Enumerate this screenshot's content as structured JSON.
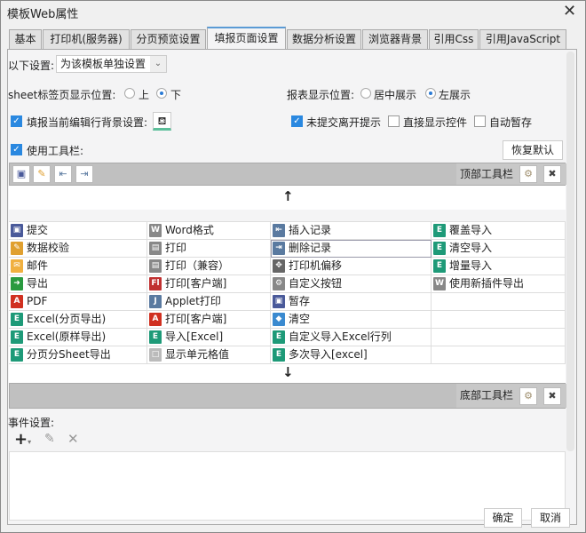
{
  "window": {
    "title": "模板Web属性"
  },
  "tabs": [
    "基本",
    "打印机(服务器)",
    "分页预览设置",
    "填报页面设置",
    "数据分析设置",
    "浏览器背景",
    "引用Css",
    "引用JavaScript"
  ],
  "settings": {
    "scope_label": "以下设置:",
    "scope_value": "为该模板单独设置",
    "sheet_label": "sheet标签页显示位置:",
    "sheet_top": "上",
    "sheet_bottom": "下",
    "report_label": "报表显示位置:",
    "report_center": "居中展示",
    "report_left": "左展示",
    "bg_label": "填报当前编辑行背景设置:",
    "leave_label": "未提交离开提示",
    "direct_label": "直接显示控件",
    "autosave_label": "自动暂存",
    "toolbar_label": "使用工具栏:",
    "restore_label": "恢复默认"
  },
  "top_toolbar": {
    "label": "顶部工具栏",
    "icons": [
      "save",
      "verify",
      "insert-row",
      "delete-row"
    ]
  },
  "bottom_toolbar": {
    "label": "底部工具栏"
  },
  "buttons": [
    [
      {
        "label": "提交",
        "icon": "save",
        "color": "#4a5a9a"
      },
      {
        "label": "Word格式",
        "icon": "word",
        "color": "#888"
      },
      {
        "label": "插入记录",
        "icon": "insert-row",
        "color": "#5a7aa0"
      },
      {
        "label": "覆盖导入",
        "icon": "excel",
        "color": "#1e9a78"
      }
    ],
    [
      {
        "label": "数据校验",
        "icon": "verify",
        "color": "#e0a030"
      },
      {
        "label": "打印",
        "icon": "print",
        "color": "#888"
      },
      {
        "label": "删除记录",
        "icon": "delete-row",
        "color": "#5a7aa0"
      },
      {
        "label": "清空导入",
        "icon": "excel",
        "color": "#1e9a78"
      }
    ],
    [
      {
        "label": "邮件",
        "icon": "mail",
        "color": "#f0b040"
      },
      {
        "label": "打印（兼容）",
        "icon": "print",
        "color": "#888"
      },
      {
        "label": "打印机偏移",
        "icon": "move",
        "color": "#666"
      },
      {
        "label": "增量导入",
        "icon": "excel",
        "color": "#1e9a78"
      }
    ],
    [
      {
        "label": "导出",
        "icon": "export",
        "color": "#2a9a40"
      },
      {
        "label": "打印[客户端]",
        "icon": "flash",
        "color": "#c03030"
      },
      {
        "label": "自定义按钮",
        "icon": "gear",
        "color": "#888"
      },
      {
        "label": "使用新插件导出",
        "icon": "word",
        "color": "#888"
      }
    ],
    [
      {
        "label": "PDF",
        "icon": "pdf",
        "color": "#d03020"
      },
      {
        "label": "Applet打印",
        "icon": "java",
        "color": "#5a7aa0"
      },
      {
        "label": "暂存",
        "icon": "save-clock",
        "color": "#4a5a9a"
      },
      {
        "label": "",
        "icon": "",
        "color": ""
      }
    ],
    [
      {
        "label": "Excel(分页导出)",
        "icon": "excel",
        "color": "#1e9a78"
      },
      {
        "label": "打印[客户端]",
        "icon": "pdf",
        "color": "#d03020"
      },
      {
        "label": "清空",
        "icon": "eraser",
        "color": "#3a8ad0"
      },
      {
        "label": "",
        "icon": "",
        "color": ""
      }
    ],
    [
      {
        "label": "Excel(原样导出)",
        "icon": "excel",
        "color": "#1e9a78"
      },
      {
        "label": "导入[Excel]",
        "icon": "excel",
        "color": "#1e9a78"
      },
      {
        "label": "自定义导入Excel行列",
        "icon": "excel",
        "color": "#1e9a78"
      },
      {
        "label": "",
        "icon": "",
        "color": ""
      }
    ],
    [
      {
        "label": "分页分Sheet导出",
        "icon": "excel",
        "color": "#1e9a78"
      },
      {
        "label": "显示单元格值",
        "icon": "cell",
        "color": "#bbb"
      },
      {
        "label": "多次导入[excel]",
        "icon": "excel",
        "color": "#1e9a78"
      },
      {
        "label": "",
        "icon": "",
        "color": ""
      }
    ]
  ],
  "events": {
    "label": "事件设置:"
  },
  "footer": {
    "ok": "确定",
    "cancel": "取消"
  }
}
